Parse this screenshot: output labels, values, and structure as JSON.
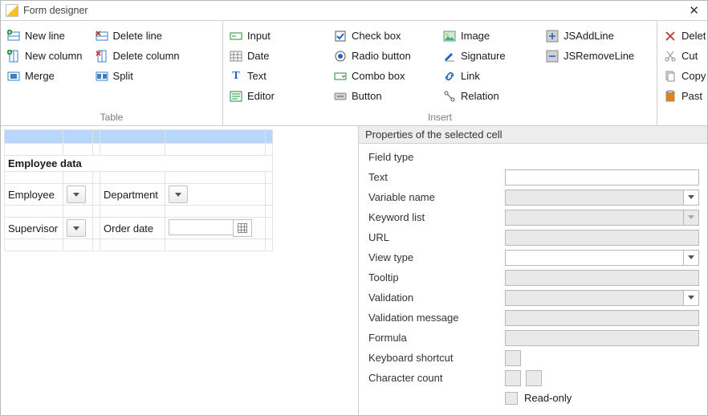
{
  "window": {
    "title": "Form designer"
  },
  "ribbon": {
    "groups": {
      "table": {
        "label": "Table",
        "col0": {
          "new_line": "New line",
          "new_column": "New column",
          "merge": "Merge"
        },
        "col1": {
          "delete_line": "Delete line",
          "delete_column": "Delete column",
          "split": "Split"
        }
      },
      "insert": {
        "label": "Insert",
        "col0": {
          "input": "Input",
          "date": "Date",
          "text": "Text",
          "editor": "Editor"
        },
        "col1": {
          "checkbox": "Check box",
          "radio": "Radio button",
          "combo": "Combo box",
          "button": "Button"
        },
        "col2": {
          "image": "Image",
          "signature": "Signature",
          "link": "Link",
          "relation": "Relation"
        },
        "col3": {
          "jsadd": "JSAddLine",
          "jsremove": "JSRemoveLine"
        }
      },
      "clipboard": {
        "delete": "Delet",
        "cut": "Cut",
        "copy": "Copy",
        "paste": "Past"
      }
    }
  },
  "designer": {
    "section_title": "Employee data",
    "labels": {
      "employee": "Employee",
      "department": "Department",
      "supervisor": "Supervisor",
      "order_date": "Order date"
    }
  },
  "properties": {
    "header": "Properties of the selected cell",
    "labels": {
      "field_type": "Field type",
      "text": "Text",
      "variable_name": "Variable name",
      "keyword_list": "Keyword list",
      "url": "URL",
      "view_type": "View type",
      "tooltip": "Tooltip",
      "validation": "Validation",
      "validation_message": "Validation message",
      "formula": "Formula",
      "keyboard_shortcut": "Keyboard shortcut",
      "character_count": "Character count",
      "read_only": "Read-only"
    },
    "values": {
      "text": "",
      "variable_name": "",
      "keyword_list": "",
      "url": "",
      "view_type": "",
      "tooltip": "",
      "validation": "",
      "validation_message": "",
      "formula": "",
      "keyboard_shortcut": "",
      "char_min": "",
      "char_max": ""
    }
  }
}
